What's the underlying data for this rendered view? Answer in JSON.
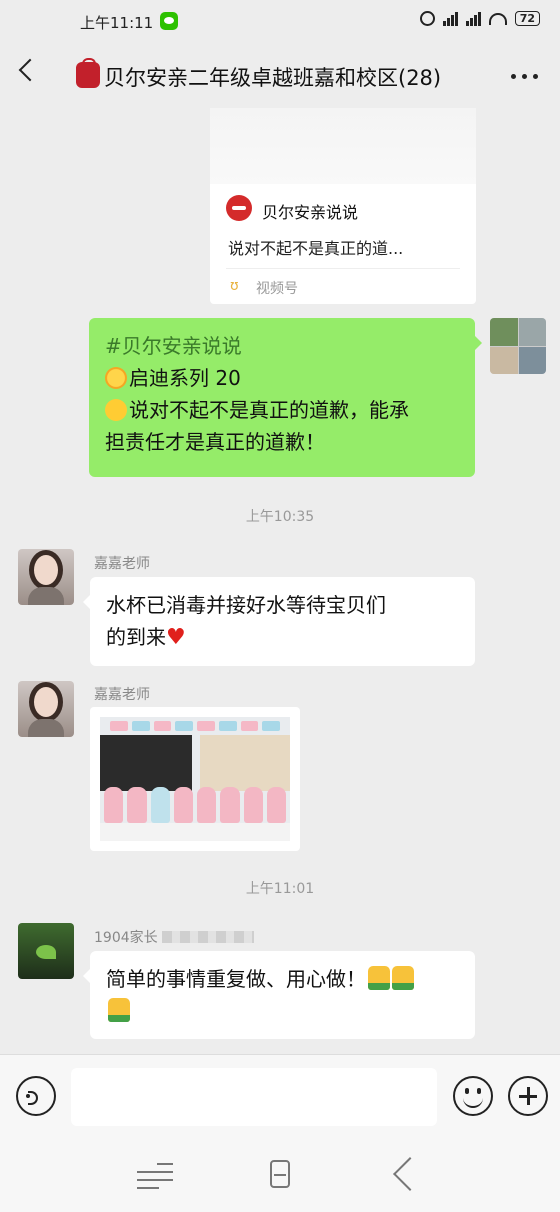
{
  "status_bar": {
    "time": "上午11:11",
    "battery": "72"
  },
  "header": {
    "title": "贝尔安亲二年级卓越班嘉和校区(28)"
  },
  "video_card": {
    "account_name": "贝尔安亲说说",
    "description": "说对不起不是真正的道...",
    "channel_label": "视频号"
  },
  "self_message": {
    "hashtag": "#贝尔安亲说说",
    "line2": "启迪系列 20",
    "line3": "说对不起不是真正的道歉，能承",
    "line4": "担责任才是真正的道歉！"
  },
  "timestamps": [
    "上午10:35",
    "上午11:01"
  ],
  "messages": [
    {
      "sender": "嘉嘉老师",
      "line1": "水杯已消毒并接好水等待宝贝们",
      "line2": "的到来"
    },
    {
      "sender": "嘉嘉老师",
      "type": "image"
    },
    {
      "sender": "1904家长",
      "line1": "简单的事情重复做、用心做！"
    }
  ],
  "input_bar": {
    "placeholder": ""
  },
  "colors": {
    "chat_bg": "#ededed",
    "self_bubble": "#95ec69",
    "accent_red": "#c2202b"
  }
}
